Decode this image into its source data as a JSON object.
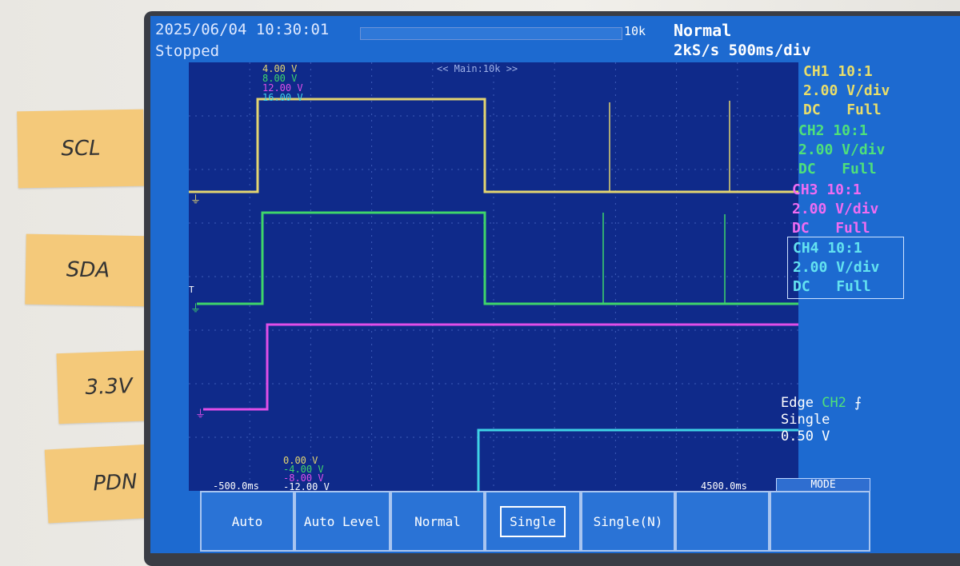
{
  "tapes": {
    "scl": "SCL",
    "sda": "SDA",
    "v33": "3.3V",
    "pdn": "PDN"
  },
  "header": {
    "timestamp": "2025/06/04 10:30:01",
    "status": "Stopped",
    "record_length": "10k",
    "trigger_mode": "Normal",
    "sample_rate": "2kS/s 500ms/div"
  },
  "plot": {
    "main_zoom": "<< Main:10k >>",
    "top_labels": [
      "4.00 V",
      "8.00 V",
      "12.00 V",
      "16.00 V"
    ],
    "bottom_labels": [
      "0.00 V",
      "-4.00 V",
      "-8.00 V",
      "-12.00 V"
    ],
    "time_left": "-500.0ms",
    "time_right": "4500.0ms"
  },
  "channels": [
    {
      "name": "CH1 10:1",
      "scale": "2.00 V/div",
      "coupling": "DC",
      "bandwidth": "Full",
      "color": "#e9de6a"
    },
    {
      "name": "CH2 10:1",
      "scale": "2.00 V/div",
      "coupling": "DC",
      "bandwidth": "Full",
      "color": "#4fe07a"
    },
    {
      "name": "CH3 10:1",
      "scale": "2.00 V/div",
      "coupling": "DC",
      "bandwidth": "Full",
      "color": "#ef6cf2"
    },
    {
      "name": "CH4 10:1",
      "scale": "2.00 V/div",
      "coupling": "DC",
      "bandwidth": "Full",
      "color": "#63e2f0"
    }
  ],
  "trigger": {
    "type": "Edge",
    "source": "CH2",
    "mode": "Single",
    "level": "0.50 V"
  },
  "softkeys": {
    "auto": "Auto",
    "auto_level": "Auto Level",
    "normal": "Normal",
    "single": "Single",
    "single_n": "Single(N)",
    "empty": "",
    "mode_label": "MODE"
  },
  "colors": {
    "screen_bg": "#1d6ad0",
    "plot_bg": "#0f2a8a",
    "grid": "#3e5cb8"
  }
}
